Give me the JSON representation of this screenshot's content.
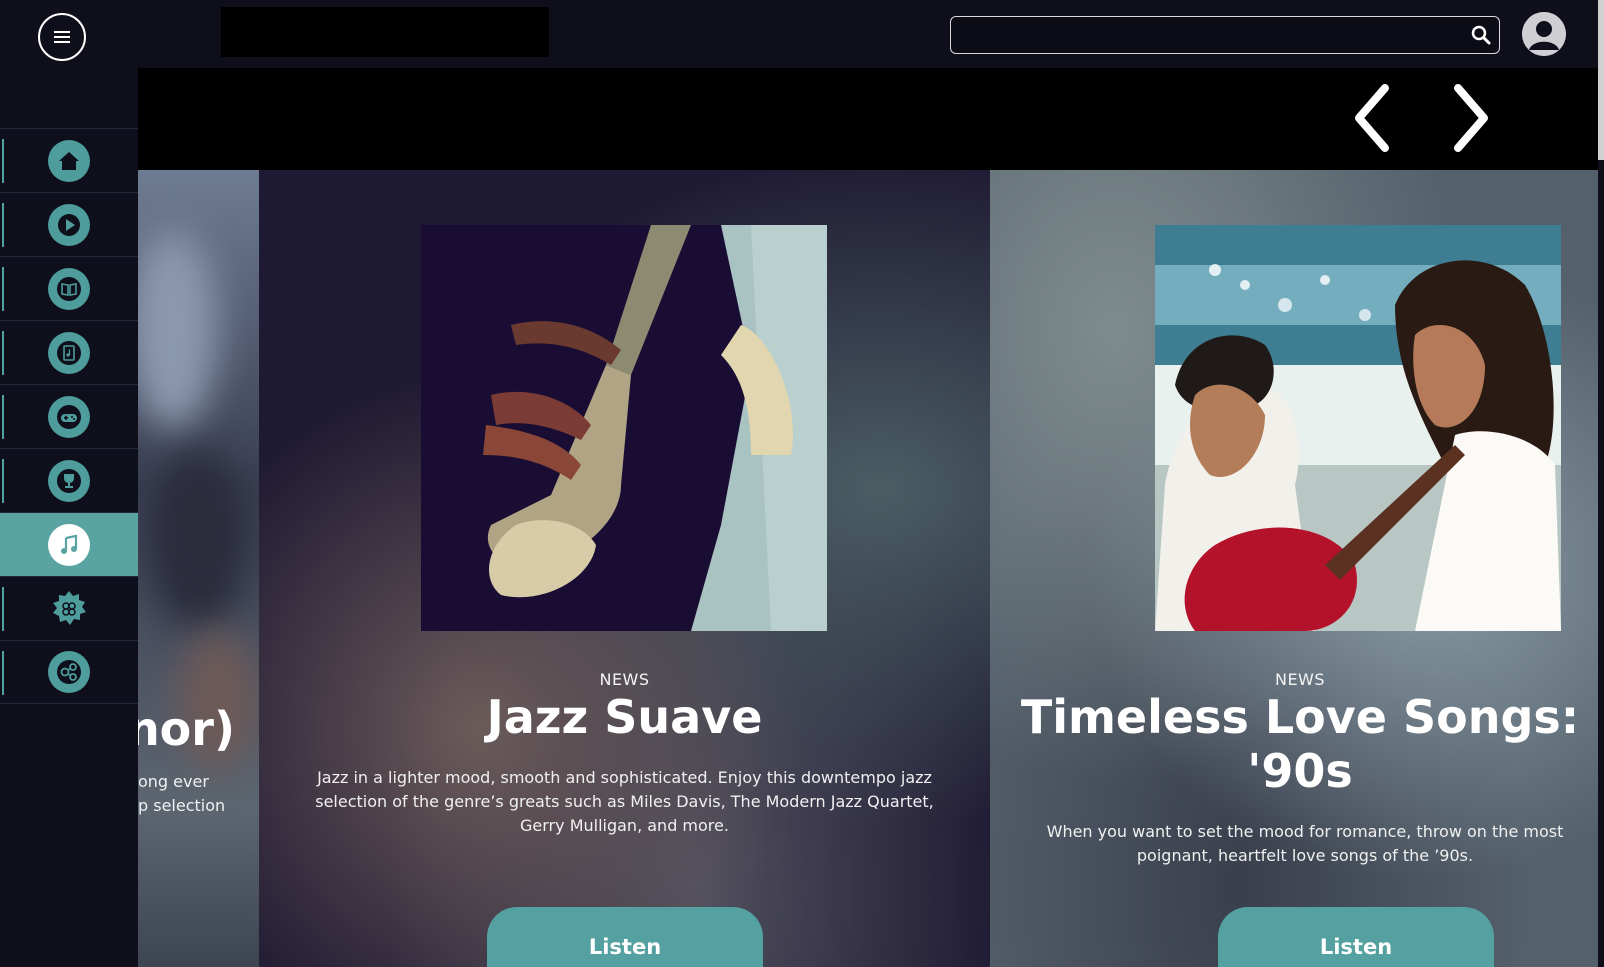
{
  "header": {
    "search_placeholder": "",
    "search_icon": "search-icon",
    "avatar_icon": "user-avatar-icon",
    "menu_icon": "hamburger-menu-icon"
  },
  "sidebar": {
    "items": [
      {
        "icon": "home-icon"
      },
      {
        "icon": "play-icon"
      },
      {
        "icon": "book-icon"
      },
      {
        "icon": "music-book-icon"
      },
      {
        "icon": "gamepad-icon"
      },
      {
        "icon": "trophy-icon"
      },
      {
        "icon": "music-note-icon",
        "active": true
      },
      {
        "icon": "settings-flower-icon"
      },
      {
        "icon": "network-icon"
      }
    ]
  },
  "hero": {
    "prev_icon": "chevron-left-icon",
    "next_icon": "chevron-right-icon"
  },
  "cards": [
    {
      "title_fragment": "nor)",
      "desc_line1": "ong ever",
      "desc_line2": "p selection"
    },
    {
      "kicker": "NEWS",
      "title": "Jazz Suave",
      "desc": "Jazz in a lighter mood, smooth and sophisticated. Enjoy this downtempo jazz selection of the genre’s greats such as Miles Davis, The Modern Jazz Quartet, Gerry Mulligan, and more.",
      "button": "Listen"
    },
    {
      "kicker": "NEWS",
      "title": "Timeless Love Songs: '90s",
      "desc": "When you want to set the mood for romance, throw on the most poignant, heartfelt love songs of the ’90s.",
      "button": "Listen"
    }
  ],
  "colors": {
    "accent": "#55a0a0",
    "background": "#0e0f1b"
  }
}
